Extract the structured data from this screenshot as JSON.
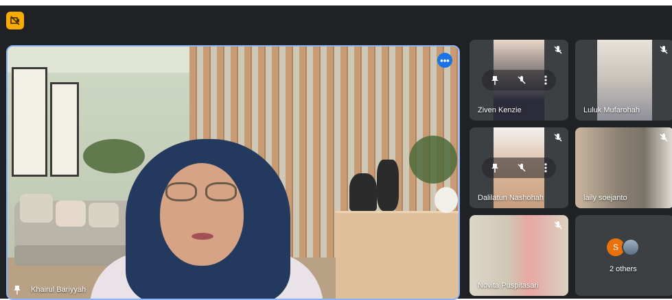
{
  "meeting": {
    "featured": {
      "name": "Khairul Bariyyah"
    },
    "tiles": [
      {
        "name": "Ziven Kenzie"
      },
      {
        "name": "Luluk Mufarohah"
      },
      {
        "name": "Dalilatun Nashohah"
      },
      {
        "name": "laily soejanto"
      },
      {
        "name": "Novita Puspitasari"
      }
    ],
    "others": {
      "label": "2 others",
      "avatar_letter": "S"
    },
    "more_label": "•••"
  },
  "colors": {
    "accent": "#8ab4f8",
    "more_button": "#1a73e8",
    "badge": "#f9ab00",
    "background": "#202124",
    "tile_bg": "#3c4043"
  },
  "icons": [
    "camera-off-icon",
    "more-options-icon",
    "pin-icon",
    "mic-off-icon",
    "more-vert-icon"
  ]
}
